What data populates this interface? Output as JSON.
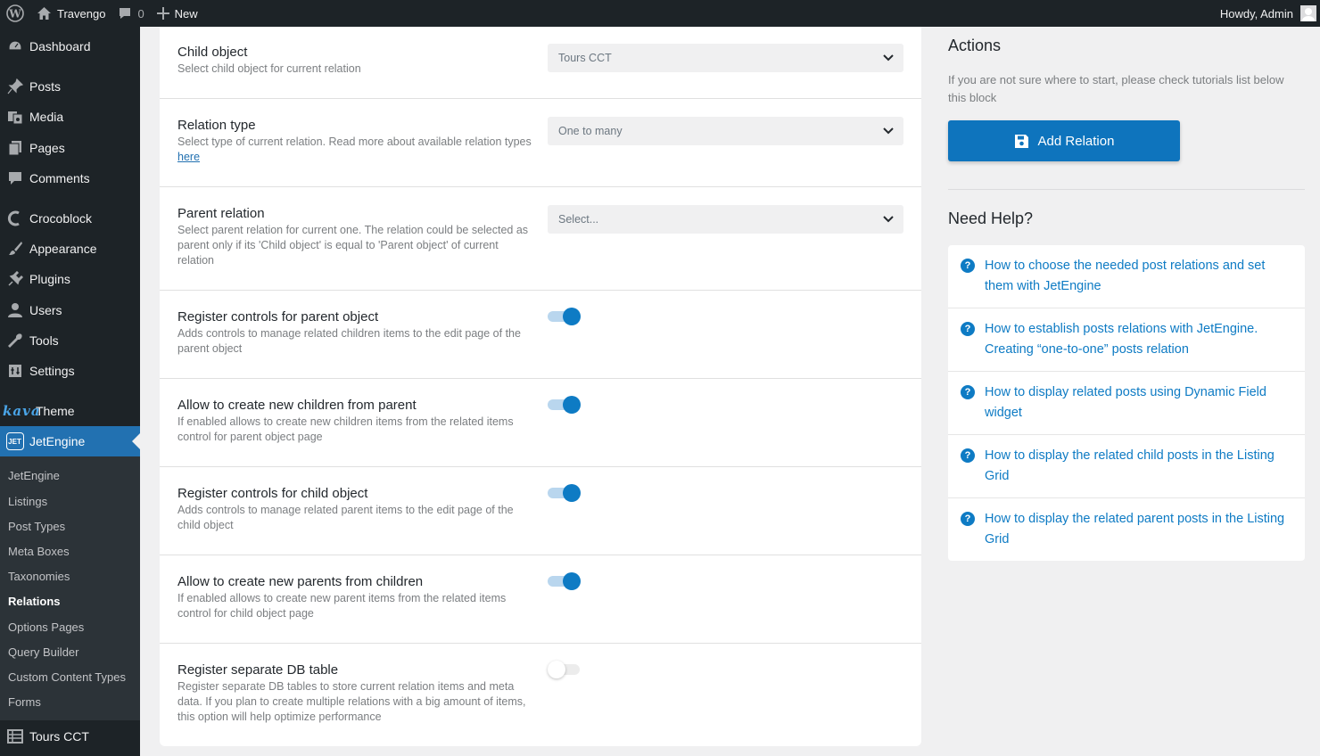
{
  "adminbar": {
    "site_name": "Travengo",
    "comments_count": "0",
    "new_label": "New",
    "howdy": "Howdy, Admin"
  },
  "sidebar": {
    "items": [
      {
        "label": "Dashboard",
        "icon": "dashboard-icon"
      },
      {
        "label": "Posts",
        "icon": "pin-icon"
      },
      {
        "label": "Media",
        "icon": "media-icon"
      },
      {
        "label": "Pages",
        "icon": "pages-icon"
      },
      {
        "label": "Comments",
        "icon": "comment-icon"
      },
      {
        "label": "Crocoblock",
        "icon": "crocoblock-icon"
      },
      {
        "label": "Appearance",
        "icon": "brush-icon"
      },
      {
        "label": "Plugins",
        "icon": "plugin-icon"
      },
      {
        "label": "Users",
        "icon": "user-icon"
      },
      {
        "label": "Tools",
        "icon": "wrench-icon"
      },
      {
        "label": "Settings",
        "icon": "settings-icon"
      },
      {
        "label": "Theme",
        "icon": "kava-logo",
        "logo_text": "kava"
      },
      {
        "label": "JetEngine",
        "icon": "jetengine-icon",
        "logo_text": "JET"
      },
      {
        "label": "Tours CCT",
        "icon": "table-icon"
      }
    ],
    "submenu": [
      "JetEngine",
      "Listings",
      "Post Types",
      "Meta Boxes",
      "Taxonomies",
      "Relations",
      "Options Pages",
      "Query Builder",
      "Custom Content Types",
      "Forms"
    ]
  },
  "settings": {
    "child_object": {
      "label": "Child object",
      "desc": "Select child object for current relation",
      "value": "Tours CCT"
    },
    "relation_type": {
      "label": "Relation type",
      "desc": "Select type of current relation. Read more about available relation types ",
      "link": "here",
      "value": "One to many"
    },
    "parent_relation": {
      "label": "Parent relation",
      "desc": "Select parent relation for current one. The relation could be selected as parent only if its 'Child object' is equal to 'Parent object' of current relation",
      "value": "Select..."
    },
    "toggles": [
      {
        "label": "Register controls for parent object",
        "desc": "Adds controls to manage related children items to the edit page of the parent object",
        "on": true
      },
      {
        "label": "Allow to create new children from parent",
        "desc": "If enabled allows to create new children items from the related items control for parent object page",
        "on": true
      },
      {
        "label": "Register controls for child object",
        "desc": "Adds controls to manage related parent items to the edit page of the child object",
        "on": true
      },
      {
        "label": "Allow to create new parents from children",
        "desc": "If enabled allows to create new parent items from the related items control for child object page",
        "on": true
      },
      {
        "label": "Register separate DB table",
        "desc": "Register separate DB tables to store current relation items and meta data. If you plan to create multiple relations with a big amount of items, this option will help optimize performance",
        "on": false
      }
    ]
  },
  "actions": {
    "title": "Actions",
    "hint": "If you are not sure where to start, please check tutorials list below this block",
    "button": "Add Relation"
  },
  "help": {
    "title": "Need Help?",
    "items": [
      "How to choose the needed post relations and set them with JetEngine",
      "How to establish posts relations with JetEngine. Creating “one-to-one” posts relation",
      "How to display related posts using Dynamic Field widget",
      "How to display the related child posts in the Listing Grid",
      "How to display the related parent posts in the Listing Grid"
    ]
  },
  "colors": {
    "accent": "#0e74bd",
    "sidebar_bg": "#1d2327",
    "active_menu": "#2271b1"
  }
}
